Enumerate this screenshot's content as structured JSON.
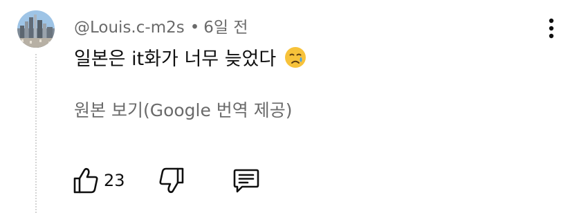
{
  "comment": {
    "author": "@Louis.c-m2s",
    "separator": "•",
    "time": "6일 전",
    "text": "일본은 it화가 너무 늦었다",
    "emoji": "crying-face-emoji",
    "translate_link": "원본 보기(Google 번역 제공)",
    "like_count": "23"
  },
  "icons": {
    "avatar": "city-skyline-avatar",
    "more": "more-vertical-icon",
    "like": "thumbs-up-icon",
    "dislike": "thumbs-down-icon",
    "reply": "reply-comment-icon"
  },
  "colors": {
    "primary_text": "#0f0f0f",
    "secondary_text": "#6a6a6a",
    "emoji_face": "#f7c23a",
    "tear": "#4aa3e8"
  }
}
